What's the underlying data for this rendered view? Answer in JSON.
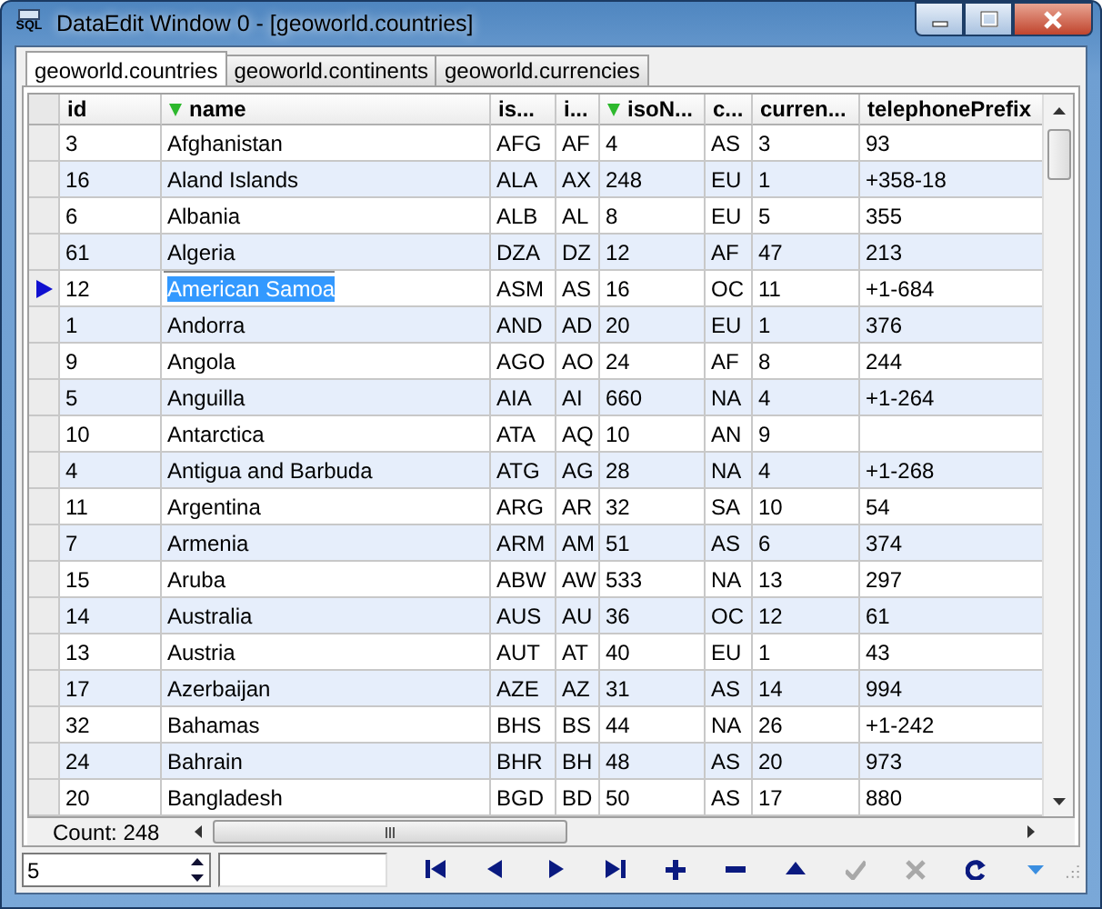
{
  "window": {
    "title": "DataEdit Window 0 - [geoworld.countries]",
    "icon_text": "SQL"
  },
  "tabs": [
    {
      "label": "geoworld.countries",
      "selected": true
    },
    {
      "label": "geoworld.continents",
      "selected": false
    },
    {
      "label": "geoworld.currencies",
      "selected": false
    }
  ],
  "table": {
    "columns": [
      {
        "label": "id",
        "sorted": false
      },
      {
        "label": "name",
        "sorted": true
      },
      {
        "label": "is...",
        "sorted": false
      },
      {
        "label": "i...",
        "sorted": false
      },
      {
        "label": "isoN...",
        "sorted": true
      },
      {
        "label": "c...",
        "sorted": false
      },
      {
        "label": "curren...",
        "sorted": false
      },
      {
        "label": "telephonePrefix",
        "sorted": false
      }
    ],
    "rows": [
      {
        "selected": false,
        "cells": [
          "3",
          "Afghanistan",
          "AFG",
          "AF",
          "4",
          "AS",
          "3",
          "93"
        ]
      },
      {
        "selected": false,
        "cells": [
          "16",
          "Aland Islands",
          "ALA",
          "AX",
          "248",
          "EU",
          "1",
          "+358-18"
        ]
      },
      {
        "selected": false,
        "cells": [
          "6",
          "Albania",
          "ALB",
          "AL",
          "8",
          "EU",
          "5",
          "355"
        ]
      },
      {
        "selected": false,
        "cells": [
          "61",
          "Algeria",
          "DZA",
          "DZ",
          "12",
          "AF",
          "47",
          "213"
        ]
      },
      {
        "selected": true,
        "cells": [
          "12",
          "American Samoa",
          "ASM",
          "AS",
          "16",
          "OC",
          "11",
          "+1-684"
        ]
      },
      {
        "selected": false,
        "cells": [
          "1",
          "Andorra",
          "AND",
          "AD",
          "20",
          "EU",
          "1",
          "376"
        ]
      },
      {
        "selected": false,
        "cells": [
          "9",
          "Angola",
          "AGO",
          "AO",
          "24",
          "AF",
          "8",
          "244"
        ]
      },
      {
        "selected": false,
        "cells": [
          "5",
          "Anguilla",
          "AIA",
          "AI",
          "660",
          "NA",
          "4",
          "+1-264"
        ]
      },
      {
        "selected": false,
        "cells": [
          "10",
          "Antarctica",
          "ATA",
          "AQ",
          "10",
          "AN",
          "9",
          ""
        ]
      },
      {
        "selected": false,
        "cells": [
          "4",
          "Antigua and Barbuda",
          "ATG",
          "AG",
          "28",
          "NA",
          "4",
          "+1-268"
        ]
      },
      {
        "selected": false,
        "cells": [
          "11",
          "Argentina",
          "ARG",
          "AR",
          "32",
          "SA",
          "10",
          "54"
        ]
      },
      {
        "selected": false,
        "cells": [
          "7",
          "Armenia",
          "ARM",
          "AM",
          "51",
          "AS",
          "6",
          "374"
        ]
      },
      {
        "selected": false,
        "cells": [
          "15",
          "Aruba",
          "ABW",
          "AW",
          "533",
          "NA",
          "13",
          "297"
        ]
      },
      {
        "selected": false,
        "cells": [
          "14",
          "Australia",
          "AUS",
          "AU",
          "36",
          "OC",
          "12",
          "61"
        ]
      },
      {
        "selected": false,
        "cells": [
          "13",
          "Austria",
          "AUT",
          "AT",
          "40",
          "EU",
          "1",
          "43"
        ]
      },
      {
        "selected": false,
        "cells": [
          "17",
          "Azerbaijan",
          "AZE",
          "AZ",
          "31",
          "AS",
          "14",
          "994"
        ]
      },
      {
        "selected": false,
        "cells": [
          "32",
          "Bahamas",
          "BHS",
          "BS",
          "44",
          "NA",
          "26",
          "+1-242"
        ]
      },
      {
        "selected": false,
        "cells": [
          "24",
          "Bahrain",
          "BHR",
          "BH",
          "48",
          "AS",
          "20",
          "973"
        ]
      },
      {
        "selected": false,
        "cells": [
          "20",
          "Bangladesh",
          "BGD",
          "BD",
          "50",
          "AS",
          "17",
          "880"
        ]
      }
    ]
  },
  "status": {
    "count": "Count: 248"
  },
  "navigator": {
    "spin_value": "5",
    "buttons": [
      {
        "kind": "first",
        "disabled": false
      },
      {
        "kind": "prior",
        "disabled": false
      },
      {
        "kind": "next",
        "disabled": false
      },
      {
        "kind": "last",
        "disabled": false
      },
      {
        "kind": "insert",
        "disabled": false
      },
      {
        "kind": "delete",
        "disabled": false
      },
      {
        "kind": "edit",
        "disabled": false
      },
      {
        "kind": "post",
        "disabled": true
      },
      {
        "kind": "cancel",
        "disabled": true
      },
      {
        "kind": "refresh",
        "disabled": false
      },
      {
        "kind": "more",
        "disabled": false
      }
    ]
  }
}
